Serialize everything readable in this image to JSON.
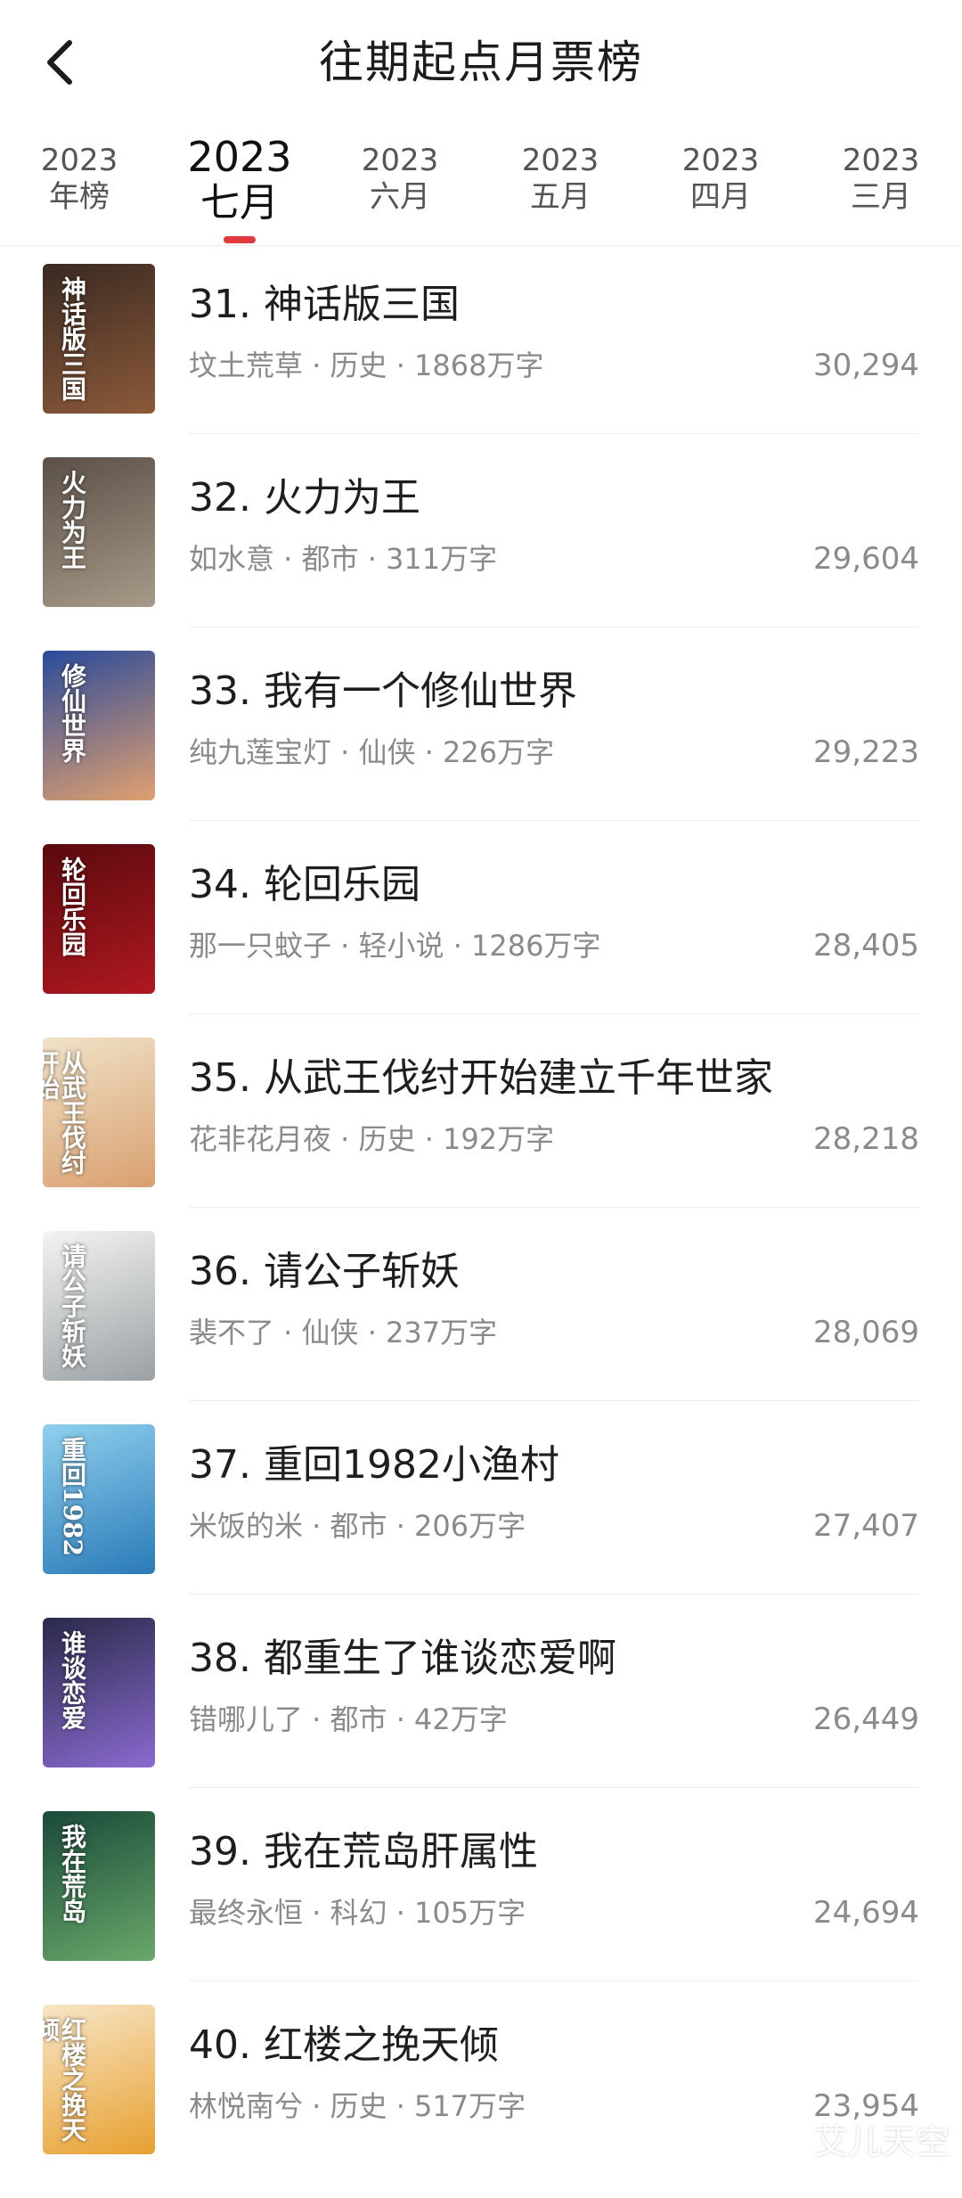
{
  "header": {
    "title": "往期起点月票榜"
  },
  "tabs": [
    {
      "year": "2023",
      "label": "年榜"
    },
    {
      "year": "2023",
      "label": "七月",
      "active": true
    },
    {
      "year": "2023",
      "label": "六月"
    },
    {
      "year": "2023",
      "label": "五月"
    },
    {
      "year": "2023",
      "label": "四月"
    },
    {
      "year": "2023",
      "label": "三月"
    }
  ],
  "books": [
    {
      "title": "31. 神话版三国",
      "meta": "坟土荒草 · 历史 · 1868万字",
      "votes": "30,294",
      "cover_text": "神话版三国",
      "cover_colors": [
        "#3a2a22",
        "#8c5a3a"
      ]
    },
    {
      "title": "32. 火力为王",
      "meta": "如水意 · 都市 · 311万字",
      "votes": "29,604",
      "cover_text": "火力为王",
      "cover_colors": [
        "#5b5048",
        "#a89a88"
      ]
    },
    {
      "title": "33. 我有一个修仙世界",
      "meta": "纯九莲宝灯 · 仙侠 · 226万字",
      "votes": "29,223",
      "cover_text": "修仙世界",
      "cover_colors": [
        "#2a4a9a",
        "#e0a070"
      ]
    },
    {
      "title": "34. 轮回乐园",
      "meta": "那一只蚊子 · 轻小说 · 1286万字",
      "votes": "28,405",
      "cover_text": "轮回乐园",
      "cover_colors": [
        "#5a0a0e",
        "#b01820"
      ]
    },
    {
      "title": "35. 从武王伐纣开始建立千年世家",
      "meta": "花非花月夜 · 历史 · 192万字",
      "votes": "28,218",
      "cover_text": "从武王伐纣开始",
      "cover_colors": [
        "#f0e2c8",
        "#d9a070"
      ]
    },
    {
      "title": "36. 请公子斩妖",
      "meta": "裴不了 · 仙侠 · 237万字",
      "votes": "28,069",
      "cover_text": "请公子斩妖",
      "cover_colors": [
        "#f4f4f2",
        "#9aa0a4"
      ]
    },
    {
      "title": "37. 重回1982小渔村",
      "meta": "米饭的米 · 都市 · 206万字",
      "votes": "27,407",
      "cover_text": "重回1982",
      "cover_colors": [
        "#8fd0ee",
        "#2a7ab8"
      ]
    },
    {
      "title": "38. 都重生了谁谈恋爱啊",
      "meta": "错哪儿了 · 都市 · 42万字",
      "votes": "26,449",
      "cover_text": "谁谈恋爱",
      "cover_colors": [
        "#2a2a4a",
        "#8a6ad0"
      ]
    },
    {
      "title": "39. 我在荒岛肝属性",
      "meta": "最终永恒 · 科幻 · 105万字",
      "votes": "24,694",
      "cover_text": "我在荒岛",
      "cover_colors": [
        "#1a4a3a",
        "#6aa86a"
      ]
    },
    {
      "title": "40. 红楼之挽天倾",
      "meta": "林悦南兮 · 历史 · 517万字",
      "votes": "23,954",
      "cover_text": "红楼之挽天倾",
      "cover_colors": [
        "#f7e6c8",
        "#e8a030"
      ]
    }
  ],
  "watermark": "艾儿天空",
  "colors": {
    "accent": "#e33a3f",
    "meta": "#8a8a8a"
  }
}
